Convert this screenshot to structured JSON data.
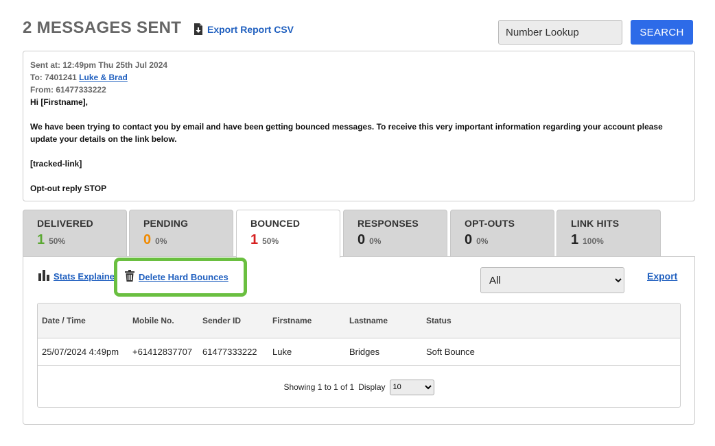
{
  "header": {
    "title": "2 MESSAGES SENT",
    "export_csv_label": "Export Report CSV",
    "export_icon": "file-download-icon",
    "lookup_placeholder": "Number Lookup",
    "search_label": "SEARCH"
  },
  "message": {
    "sent_at": "Sent at: 12:49pm Thu 25th Jul 2024",
    "to_prefix": "To: 7401241",
    "to_link": "Luke & Brad",
    "from": "From: 61477333222",
    "greeting": "Hi [Firstname],",
    "body_line1": "We have been trying to contact you by email and have been getting bounced messages. To receive this very important information regarding your account please",
    "body_line2": "update your details on the link below.",
    "tracked_link": "[tracked-link]",
    "optout": "Opt-out reply STOP"
  },
  "tabs": [
    {
      "label": "DELIVERED",
      "count": "1",
      "pct": "50%",
      "color": "#5aa832"
    },
    {
      "label": "PENDING",
      "count": "0",
      "pct": "0%",
      "color": "#f08a00"
    },
    {
      "label": "BOUNCED",
      "count": "1",
      "pct": "50%",
      "color": "#d62020",
      "active": true
    },
    {
      "label": "RESPONSES",
      "count": "0",
      "pct": "0%",
      "color": "#222222"
    },
    {
      "label": "OPT-OUTS",
      "count": "0",
      "pct": "0%",
      "color": "#222222"
    },
    {
      "label": "LINK HITS",
      "count": "1",
      "pct": "100%",
      "color": "#222222"
    }
  ],
  "toolbar": {
    "stats_label": "Stats Explained",
    "stats_icon": "bar-chart-icon",
    "delete_label": "Delete Hard Bounces",
    "delete_icon": "trash-icon",
    "highlight_color": "#6abf40",
    "filter_selected": "All",
    "export_label": "Export"
  },
  "table": {
    "columns": [
      "Date / Time",
      "Mobile No.",
      "Sender ID",
      "Firstname",
      "Lastname",
      "Status"
    ],
    "rows": [
      [
        "25/07/2024 4:49pm",
        "+61412837707",
        "61477333222",
        "Luke",
        "Bridges",
        "Soft Bounce"
      ]
    ],
    "pager_text": "Showing 1 to 1 of 1",
    "display_label": "Display",
    "display_value": "10"
  },
  "colors": {
    "accent": "#2d6be8",
    "link": "#1f5fbf"
  }
}
